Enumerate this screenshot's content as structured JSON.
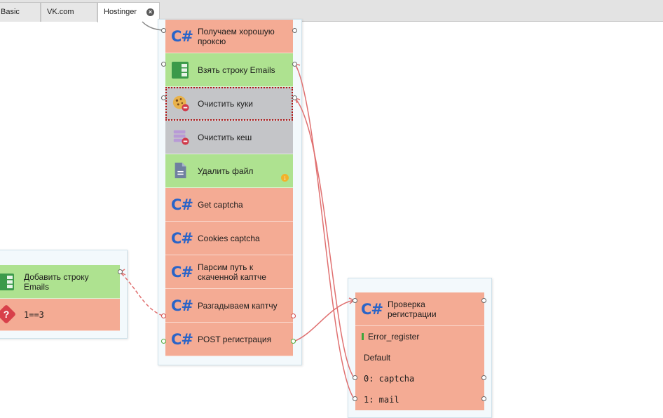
{
  "tabs": [
    {
      "label": "Basic"
    },
    {
      "label": "VK.com"
    },
    {
      "label": "Hostinger",
      "close": "×"
    }
  ],
  "main_group": {
    "nodes": [
      {
        "label": "Получаем хорошую проксю",
        "icon": "C#"
      },
      {
        "label": "Взять строку Emails"
      },
      {
        "label": "Очистить куки"
      },
      {
        "label": "Очистить кеш"
      },
      {
        "label": "Удалить файл",
        "badge": "↓"
      },
      {
        "label": "Get captcha",
        "icon": "C#"
      },
      {
        "label": "Cookies captcha",
        "icon": "C#"
      },
      {
        "label": "Парсим путь к скаченной каптче",
        "icon": "C#"
      },
      {
        "label": "Разгадываем каптчу",
        "icon": "C#"
      },
      {
        "label": "POST регистрация",
        "icon": "C#"
      }
    ]
  },
  "left_group": {
    "nodes": [
      {
        "label": "Добавить строку Emails"
      },
      {
        "label": "1==3",
        "icon": "?"
      }
    ]
  },
  "right_group": {
    "header": {
      "label": "Проверка регистрации",
      "icon": "C#"
    },
    "rows": [
      {
        "label": "Error_register"
      },
      {
        "label": "Default"
      },
      {
        "label": "0: captcha"
      },
      {
        "label": "1: mail"
      }
    ]
  },
  "colors": {
    "orange_node": "#f4ab94",
    "green_node": "#aee290",
    "gray_node": "#c4c5c8",
    "wire": "#e07070",
    "csharp": "#2a64c8"
  }
}
